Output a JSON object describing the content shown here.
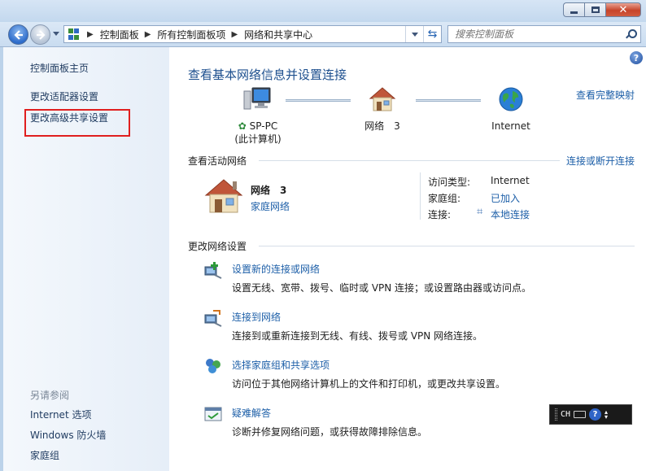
{
  "window": {
    "controls": {
      "minimize": "minimize",
      "maximize": "maximize",
      "close": "close"
    }
  },
  "address": {
    "crumbs": [
      "控制面板",
      "所有控制面板项",
      "网络和共享中心"
    ],
    "search_placeholder": "搜索控制面板"
  },
  "sidebar": {
    "links": [
      {
        "label": "控制面板主页"
      },
      {
        "label": "更改适配器设置"
      },
      {
        "label": "更改高级共享设置"
      }
    ],
    "see_also_title": "另请参阅",
    "see_also": [
      {
        "label": "Internet 选项"
      },
      {
        "label": "Windows 防火墙"
      },
      {
        "label": "家庭组"
      }
    ]
  },
  "main": {
    "title": "查看基本网络信息并设置连接",
    "view_map": "查看完整映射",
    "map": {
      "computer_name": "SP-PC",
      "computer_sub": "(此计算机)",
      "network": "网络　3",
      "internet": "Internet"
    },
    "active": {
      "heading": "查看活动网络",
      "connect_link": "连接或断开连接",
      "network_name": "网络　3",
      "network_type": "家庭网络",
      "access_type_label": "访问类型:",
      "access_type_value": "Internet",
      "homegroup_label": "家庭组:",
      "homegroup_value": "已加入",
      "connections_label": "连接:",
      "connections_value": "本地连接"
    },
    "change": {
      "heading": "更改网络设置",
      "tasks": [
        {
          "title": "设置新的连接或网络",
          "desc": "设置无线、宽带、拨号、临时或 VPN 连接；或设置路由器或访问点。"
        },
        {
          "title": "连接到网络",
          "desc": "连接到或重新连接到无线、有线、拨号或 VPN 网络连接。"
        },
        {
          "title": "选择家庭组和共享选项",
          "desc": "访问位于其他网络计算机上的文件和打印机，或更改共享设置。"
        },
        {
          "title": "疑难解答",
          "desc": "诊断并修复网络问题，或获得故障排除信息。"
        }
      ]
    }
  },
  "ime": {
    "lang": "CH"
  },
  "colors": {
    "link": "#1d5fa8",
    "title": "#1d4f8e",
    "highlight": "#e01f1f"
  }
}
